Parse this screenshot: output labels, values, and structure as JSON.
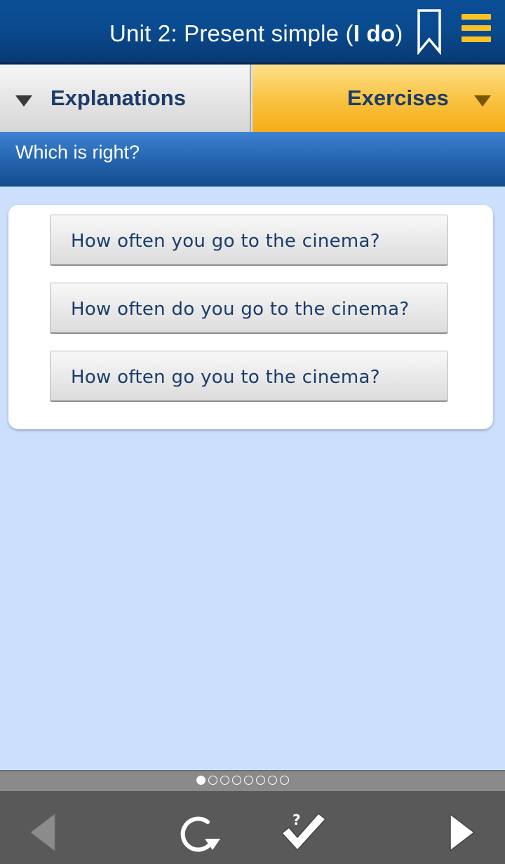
{
  "header": {
    "title_prefix": "Unit 2: Present simple (",
    "title_bold": "I do",
    "title_suffix": ")"
  },
  "tabs": [
    {
      "label": "Explanations",
      "active": false
    },
    {
      "label": "Exercises",
      "active": true
    }
  ],
  "question": {
    "text": "Which is right?"
  },
  "options": [
    {
      "label": "How often you go to the cinema?"
    },
    {
      "label": "How often do you go to the cinema?"
    },
    {
      "label": "How often go you to the cinema?"
    }
  ],
  "pager": {
    "total": 8,
    "current": 1
  },
  "toolbar": {
    "icons": [
      "previous-icon",
      "reset-icon",
      "check-answers-icon",
      "next-icon"
    ],
    "check_glyph": "?"
  },
  "colors": {
    "header_blue": "#0a4a8e",
    "tab_active_yellow": "#f9c13f",
    "accent_yellow": "#f7c228",
    "text_navy": "#1b3c6a",
    "background_light_blue": "#cce0fd",
    "toolbar_gray": "#595959"
  }
}
